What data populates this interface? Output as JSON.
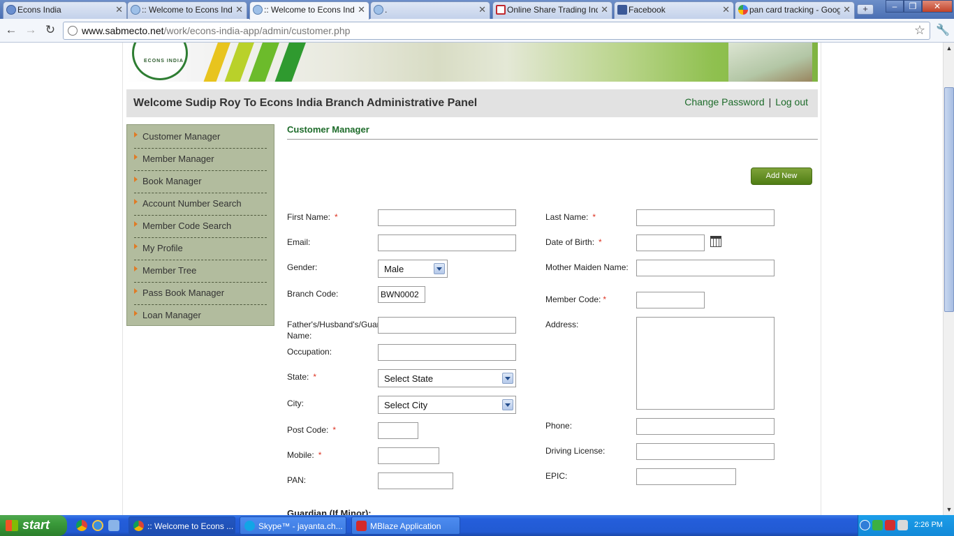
{
  "browser": {
    "tabs": [
      {
        "title": "Econs India",
        "active": false
      },
      {
        "title": ":: Welcome to Econs India",
        "active": false
      },
      {
        "title": ":: Welcome to Econs India",
        "active": true
      },
      {
        "title": ".",
        "active": false
      },
      {
        "title": "Online Share Trading India",
        "active": false
      },
      {
        "title": "Facebook",
        "active": false
      },
      {
        "title": "pan card tracking - Google",
        "active": false
      }
    ],
    "url_host": "www.sabmecto.net",
    "url_path": "/work/econs-india-app/admin/customer.php"
  },
  "banner": {
    "logo_text": "ECONS INDIA"
  },
  "header": {
    "welcome": "Welcome Sudip Roy To Econs India Branch Administrative Panel",
    "change_password": "Change Password",
    "separator": "|",
    "logout": "Log out"
  },
  "sidebar": {
    "items": [
      {
        "label": "Customer Manager"
      },
      {
        "label": "Member Manager"
      },
      {
        "label": "Book Manager"
      },
      {
        "label": "Account Number Search"
      },
      {
        "label": "Member Code Search"
      },
      {
        "label": "My Profile"
      },
      {
        "label": "Member Tree"
      },
      {
        "label": "Pass Book Manager"
      },
      {
        "label": "Loan Manager"
      }
    ]
  },
  "main": {
    "title": "Customer Manager",
    "add_new": "Add New",
    "form": {
      "first_name": "First Name:",
      "last_name": "Last Name:",
      "email": "Email:",
      "dob": "Date of Birth:",
      "gender": "Gender:",
      "gender_value": "Male",
      "mother_maiden": "Mother Maiden Name:",
      "branch_code": "Branch Code:",
      "branch_code_value": "BWN0002",
      "member_code": "Member Code:",
      "father_name": "Father's/Husband's/Guardian's Name:",
      "address": "Address:",
      "occupation": "Occupation:",
      "state": "State:",
      "state_value": "Select State",
      "city": "City:",
      "city_value": "Select City",
      "post_code": "Post Code:",
      "phone": "Phone:",
      "mobile": "Mobile:",
      "driving_license": "Driving License:",
      "pan": "PAN:",
      "epic": "EPIC:",
      "required_mark": "*",
      "guardian_heading": "Guardian (If Minor):"
    }
  },
  "taskbar": {
    "start": "start",
    "tasks": [
      {
        "label": ":: Welcome to Econs ...",
        "active": true
      },
      {
        "label": "Skype™ - jayanta.ch...",
        "active": false
      },
      {
        "label": "MBlaze Application",
        "active": false
      }
    ],
    "clock": "2:26 PM"
  },
  "colors": {
    "accent_green": "#1d6b2a",
    "sidebar_bg": "#b2bc9e",
    "button_green": "#5a8a1c",
    "required": "#dd3322"
  }
}
